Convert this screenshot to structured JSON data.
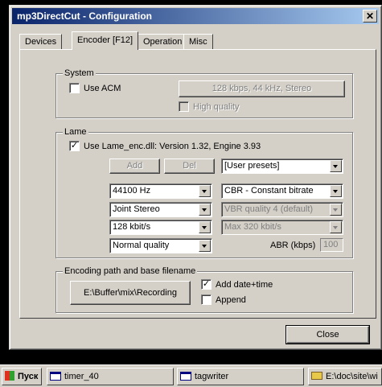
{
  "window": {
    "title": "mp3DirectCut - Configuration",
    "close_glyph": "✕"
  },
  "tabs": [
    "Devices",
    "Encoder [F12]",
    "Operation",
    "Misc"
  ],
  "active_tab": 1,
  "system": {
    "group_title": "System",
    "use_acm_label": "Use ACM",
    "use_acm_checked": false,
    "format_button": "128 kbps, 44 kHz, Stereo",
    "high_quality_label": "High quality",
    "high_quality_checked": false
  },
  "lame": {
    "group_title": "Lame",
    "use_lame_label": "Use Lame_enc.dll: Version 1.32, Engine 3.93",
    "use_lame_checked": true,
    "check_glyph": "✓",
    "add_button": "Add",
    "del_button": "Del",
    "presets_value": "[User presets]",
    "sample_rate_value": "44100 Hz",
    "mode_value": "CBR - Constant bitrate",
    "channel_value": "Joint Stereo",
    "vbr_quality_value": "VBR quality 4 (default)",
    "bitrate_value": "128 kbit/s",
    "max_bitrate_value": "Max 320 kbit/s",
    "quality_value": "Normal quality",
    "abr_label": "ABR (kbps)",
    "abr_value": "100"
  },
  "encoding": {
    "group_title": "Encoding path and base filename",
    "path_button": "E:\\Buffer\\mix\\Recording",
    "add_datetime_label": "Add date+time",
    "add_datetime_checked": true,
    "append_label": "Append",
    "append_checked": false
  },
  "close_button": "Close",
  "taskbar": {
    "start_label": "Пуск",
    "items": [
      "timer_40",
      "tagwriter",
      "E:\\doc\\site\\wi"
    ]
  }
}
